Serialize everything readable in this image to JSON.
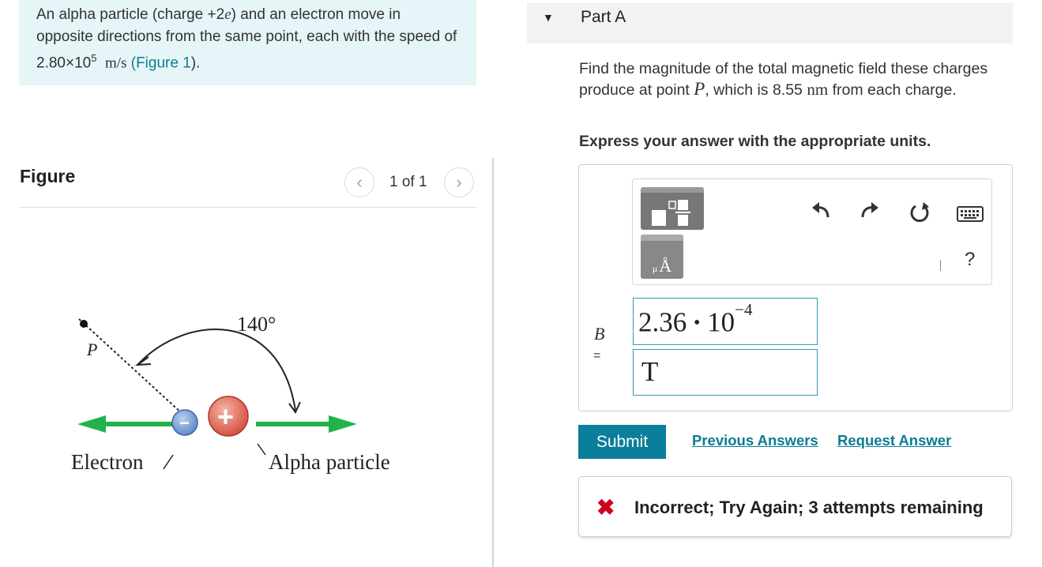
{
  "problem": {
    "text_1": "An alpha particle (charge +2",
    "e_symbol": "e",
    "text_2": ") and an electron move in opposite directions from the same point, each with the speed of 2.80×10",
    "speed_exponent": "5",
    "speed_unit": "m/s",
    "link_open": "(",
    "figure_link": "Figure 1",
    "link_close": ")."
  },
  "figure": {
    "title": "Figure",
    "pager_prev_icon": "‹",
    "pager_next_icon": "›",
    "pager_text": "1 of 1",
    "angle_label": "140°",
    "point_label": "P",
    "electron_label": "Electron",
    "alpha_label": "Alpha particle",
    "electron_sign": "−",
    "alpha_sign": "+",
    "colors": {
      "arrow_green": "#22b24c",
      "electron": "#5a86c8",
      "alpha": "#d44c3a"
    }
  },
  "part": {
    "caret_icon": "▼",
    "title": "Part A",
    "question_1": "Find the magnitude of the total magnetic field these charges produce at point ",
    "question_P": "P",
    "question_2": ", which is 8.55 ",
    "question_unit": "nm",
    "question_3": " from each charge.",
    "instruction": "Express your answer with the appropriate units."
  },
  "toolbar": {
    "units_small": "μ",
    "units_symbol": "Å",
    "help": "?",
    "icons": [
      "templates-icon",
      "units-icon",
      "undo-icon",
      "redo-icon",
      "reset-icon",
      "keyboard-icon",
      "help-icon"
    ]
  },
  "answer": {
    "variable": "B",
    "equals": "=",
    "value_mantissa": "2.36",
    "value_times": "•",
    "value_base": "10",
    "value_exponent": "−4",
    "unit": "T"
  },
  "actions": {
    "submit": "Submit",
    "previous_answers": "Previous Answers",
    "request_answer": "Request Answer"
  },
  "feedback": {
    "icon": "✖",
    "text": "Incorrect; Try Again; 3 attempts remaining",
    "color": "#d0021b"
  },
  "colors": {
    "accent": "#0b7e9b",
    "link": "#0b7c93",
    "problem_bg": "#e6f5f7"
  }
}
